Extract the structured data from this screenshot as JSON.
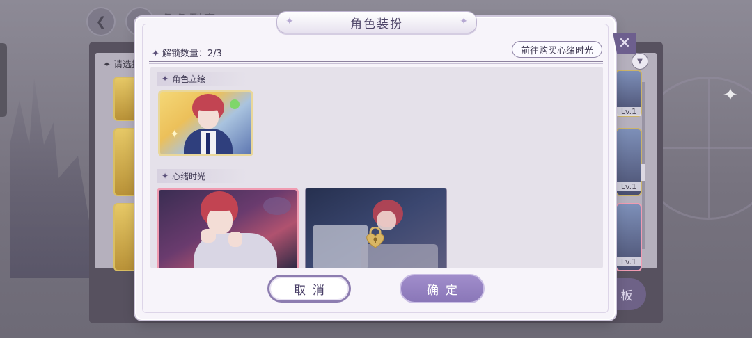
{
  "background": {
    "page_title": "角色列表",
    "list_hint": "请选择",
    "level_labels": [
      "Lv.1",
      "Lv.1",
      "Lv.1"
    ],
    "side_button_label": "板"
  },
  "modal": {
    "title": "角色装扮",
    "unlock_label": "解锁数量：",
    "unlock_count": "2/3",
    "buy_button": "前往购买心绪时光",
    "close_symbol": "✕",
    "sections": [
      {
        "label": "角色立绘"
      },
      {
        "label": "心绪时光"
      }
    ],
    "cancel_label": "取消",
    "confirm_label": "确定"
  },
  "colors": {
    "accent": "#8a77b8",
    "frame": "#cfc7dc",
    "selected_border": "#f09bb1"
  }
}
